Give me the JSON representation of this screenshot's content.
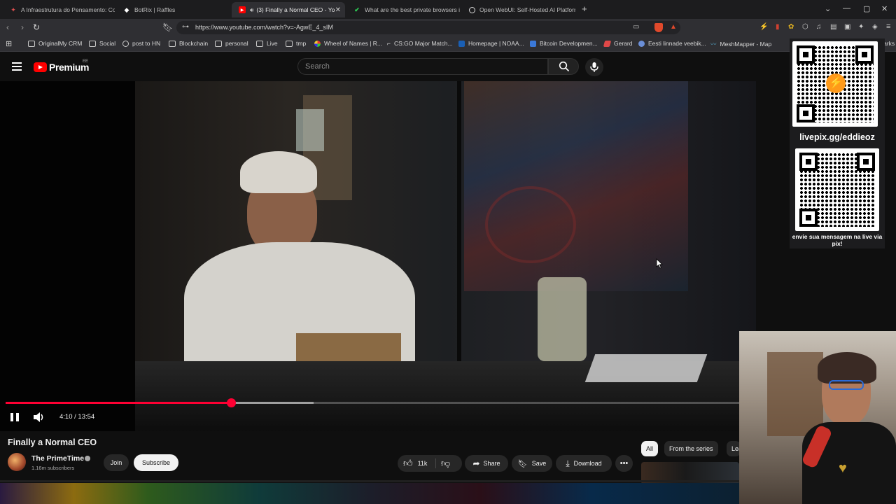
{
  "browser": {
    "tabs": [
      {
        "title": "A Infraestrutura do Pensamento: Con",
        "icon": "doc-icon",
        "active": false
      },
      {
        "title": "BotRix | Raffles",
        "icon": "botrix-icon",
        "active": false
      },
      {
        "title": "(3) Finally a Normal CEO - Yo",
        "icon": "youtube-icon",
        "active": true
      },
      {
        "title": "What are the best private browsers i",
        "icon": "check-icon",
        "active": false
      },
      {
        "title": "Open WebUI: Self-Hosted AI Platform",
        "icon": "webui-icon",
        "active": false
      }
    ],
    "url": "https://www.youtube.com/watch?v=-AgwE_4_sIM",
    "bookmarks": [
      "OriginalMy CRM",
      "Social",
      "post to HN",
      "Blockchain",
      "personal",
      "Live",
      "tmp",
      "Wheel of Names | R...",
      "CS:GO Major Match...",
      "Homepage | NOAA...",
      "Bitcoin Developmen...",
      "Gerard",
      "Eesti linnade veebik...",
      "MeshMapper - Map"
    ],
    "bookmarks_overflow": "marks"
  },
  "youtube": {
    "logo_text": "Premium",
    "logo_region": "EE",
    "search_placeholder": "Search",
    "player": {
      "current_time": "4:10",
      "duration": "13:54",
      "time_display": "4:10 / 13:54",
      "progress": 0.3,
      "buffered": 0.41,
      "state": "playing"
    },
    "video": {
      "title": "Finally a Normal CEO",
      "channel": "The PrimeTime",
      "subscribers": "1.16m subscribers",
      "likes": "11k"
    },
    "actions": {
      "join": "Join",
      "subscribe": "Subscribe",
      "share": "Share",
      "save": "Save",
      "download": "Download"
    },
    "chips": [
      "All",
      "From the series",
      "Lea"
    ]
  },
  "overlay": {
    "livepix_url": "livepix.gg/eddieoz",
    "pix_message": "envie sua mensagem na live via pix!"
  },
  "colors": {
    "yt_red": "#ff0000",
    "progress_red": "#ff0033",
    "background": "#0f0f0f"
  }
}
